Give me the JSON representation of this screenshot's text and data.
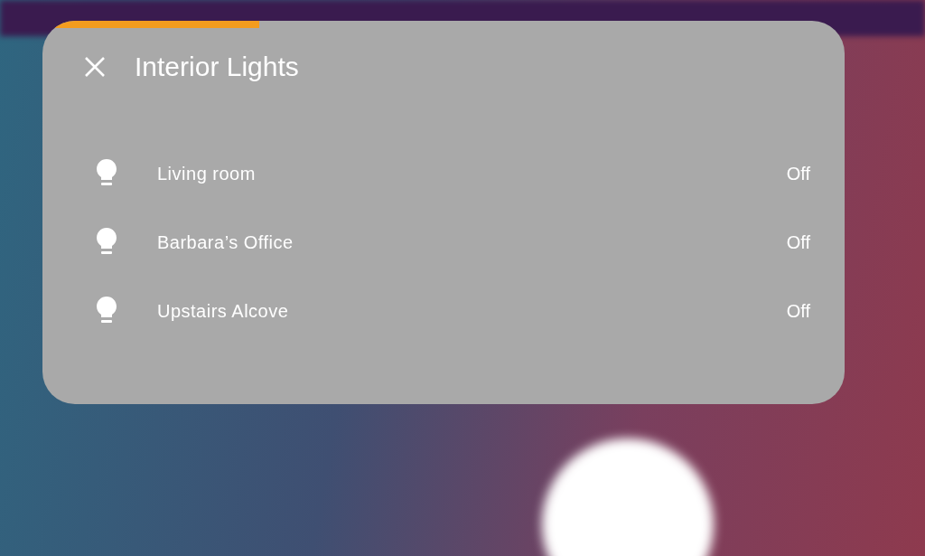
{
  "dialog": {
    "title": "Interior Lights",
    "progress": {
      "level": 0.27
    },
    "entities": [
      {
        "name": "Living room",
        "state": "Off"
      },
      {
        "name": "Barbara’s Office",
        "state": "Off"
      },
      {
        "name": "Upstairs Alcove",
        "state": "Off"
      }
    ]
  }
}
